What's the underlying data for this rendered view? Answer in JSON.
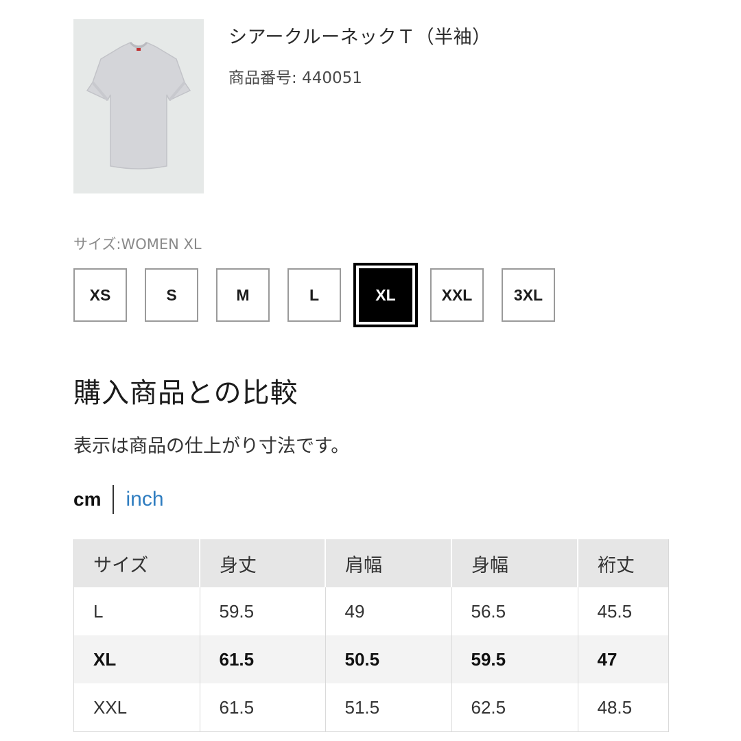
{
  "product": {
    "title": "シアークルーネックＴ（半袖）",
    "number": "商品番号: 440051",
    "image_alt": "light gray sheer crew neck t-shirt"
  },
  "size_selector": {
    "selected_label": "サイズ:WOMEN XL",
    "sizes": [
      "XS",
      "S",
      "M",
      "L",
      "XL",
      "XXL",
      "3XL"
    ],
    "selected": "XL"
  },
  "comparison": {
    "heading": "購入商品との比較",
    "note": "表示は商品の仕上がり寸法です。"
  },
  "units": {
    "cm": "cm",
    "inch": "inch",
    "active": "cm",
    "link_color": "#2f7dc0"
  },
  "size_table": {
    "headers": [
      "サイズ",
      "身丈",
      "肩幅",
      "身幅",
      "裄丈"
    ],
    "rows": [
      [
        "L",
        "59.5",
        "49",
        "56.5",
        "45.5"
      ],
      [
        "XL",
        "61.5",
        "50.5",
        "59.5",
        "47"
      ],
      [
        "XXL",
        "61.5",
        "51.5",
        "62.5",
        "48.5"
      ]
    ],
    "highlighted_row": "XL"
  }
}
